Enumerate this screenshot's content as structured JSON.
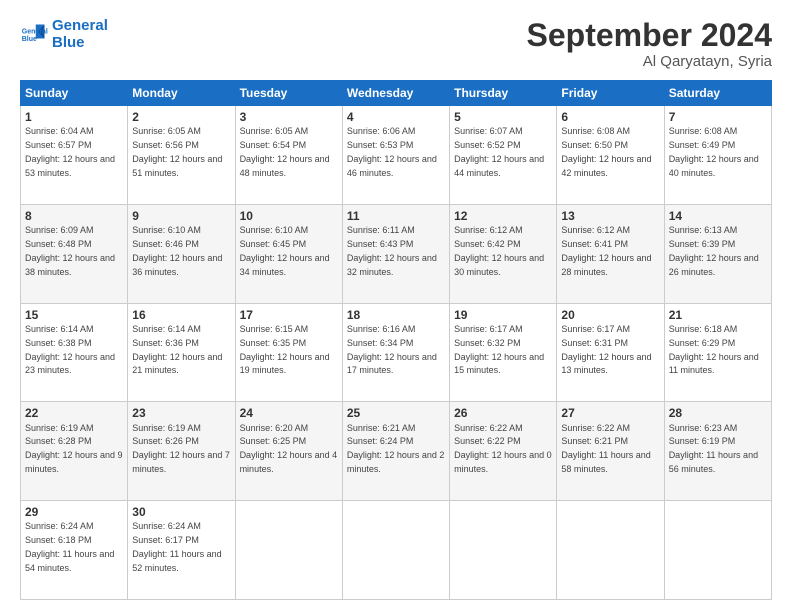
{
  "logo": {
    "line1": "General",
    "line2": "Blue"
  },
  "header": {
    "month_year": "September 2024",
    "location": "Al Qaryatayn, Syria"
  },
  "weekdays": [
    "Sunday",
    "Monday",
    "Tuesday",
    "Wednesday",
    "Thursday",
    "Friday",
    "Saturday"
  ],
  "weeks": [
    [
      {
        "day": "1",
        "sunrise": "6:04 AM",
        "sunset": "6:57 PM",
        "daylight": "12 hours and 53 minutes."
      },
      {
        "day": "2",
        "sunrise": "6:05 AM",
        "sunset": "6:56 PM",
        "daylight": "12 hours and 51 minutes."
      },
      {
        "day": "3",
        "sunrise": "6:05 AM",
        "sunset": "6:54 PM",
        "daylight": "12 hours and 48 minutes."
      },
      {
        "day": "4",
        "sunrise": "6:06 AM",
        "sunset": "6:53 PM",
        "daylight": "12 hours and 46 minutes."
      },
      {
        "day": "5",
        "sunrise": "6:07 AM",
        "sunset": "6:52 PM",
        "daylight": "12 hours and 44 minutes."
      },
      {
        "day": "6",
        "sunrise": "6:08 AM",
        "sunset": "6:50 PM",
        "daylight": "12 hours and 42 minutes."
      },
      {
        "day": "7",
        "sunrise": "6:08 AM",
        "sunset": "6:49 PM",
        "daylight": "12 hours and 40 minutes."
      }
    ],
    [
      {
        "day": "8",
        "sunrise": "6:09 AM",
        "sunset": "6:48 PM",
        "daylight": "12 hours and 38 minutes."
      },
      {
        "day": "9",
        "sunrise": "6:10 AM",
        "sunset": "6:46 PM",
        "daylight": "12 hours and 36 minutes."
      },
      {
        "day": "10",
        "sunrise": "6:10 AM",
        "sunset": "6:45 PM",
        "daylight": "12 hours and 34 minutes."
      },
      {
        "day": "11",
        "sunrise": "6:11 AM",
        "sunset": "6:43 PM",
        "daylight": "12 hours and 32 minutes."
      },
      {
        "day": "12",
        "sunrise": "6:12 AM",
        "sunset": "6:42 PM",
        "daylight": "12 hours and 30 minutes."
      },
      {
        "day": "13",
        "sunrise": "6:12 AM",
        "sunset": "6:41 PM",
        "daylight": "12 hours and 28 minutes."
      },
      {
        "day": "14",
        "sunrise": "6:13 AM",
        "sunset": "6:39 PM",
        "daylight": "12 hours and 26 minutes."
      }
    ],
    [
      {
        "day": "15",
        "sunrise": "6:14 AM",
        "sunset": "6:38 PM",
        "daylight": "12 hours and 23 minutes."
      },
      {
        "day": "16",
        "sunrise": "6:14 AM",
        "sunset": "6:36 PM",
        "daylight": "12 hours and 21 minutes."
      },
      {
        "day": "17",
        "sunrise": "6:15 AM",
        "sunset": "6:35 PM",
        "daylight": "12 hours and 19 minutes."
      },
      {
        "day": "18",
        "sunrise": "6:16 AM",
        "sunset": "6:34 PM",
        "daylight": "12 hours and 17 minutes."
      },
      {
        "day": "19",
        "sunrise": "6:17 AM",
        "sunset": "6:32 PM",
        "daylight": "12 hours and 15 minutes."
      },
      {
        "day": "20",
        "sunrise": "6:17 AM",
        "sunset": "6:31 PM",
        "daylight": "12 hours and 13 minutes."
      },
      {
        "day": "21",
        "sunrise": "6:18 AM",
        "sunset": "6:29 PM",
        "daylight": "12 hours and 11 minutes."
      }
    ],
    [
      {
        "day": "22",
        "sunrise": "6:19 AM",
        "sunset": "6:28 PM",
        "daylight": "12 hours and 9 minutes."
      },
      {
        "day": "23",
        "sunrise": "6:19 AM",
        "sunset": "6:26 PM",
        "daylight": "12 hours and 7 minutes."
      },
      {
        "day": "24",
        "sunrise": "6:20 AM",
        "sunset": "6:25 PM",
        "daylight": "12 hours and 4 minutes."
      },
      {
        "day": "25",
        "sunrise": "6:21 AM",
        "sunset": "6:24 PM",
        "daylight": "12 hours and 2 minutes."
      },
      {
        "day": "26",
        "sunrise": "6:22 AM",
        "sunset": "6:22 PM",
        "daylight": "12 hours and 0 minutes."
      },
      {
        "day": "27",
        "sunrise": "6:22 AM",
        "sunset": "6:21 PM",
        "daylight": "11 hours and 58 minutes."
      },
      {
        "day": "28",
        "sunrise": "6:23 AM",
        "sunset": "6:19 PM",
        "daylight": "11 hours and 56 minutes."
      }
    ],
    [
      {
        "day": "29",
        "sunrise": "6:24 AM",
        "sunset": "6:18 PM",
        "daylight": "11 hours and 54 minutes."
      },
      {
        "day": "30",
        "sunrise": "6:24 AM",
        "sunset": "6:17 PM",
        "daylight": "11 hours and 52 minutes."
      },
      null,
      null,
      null,
      null,
      null
    ]
  ]
}
